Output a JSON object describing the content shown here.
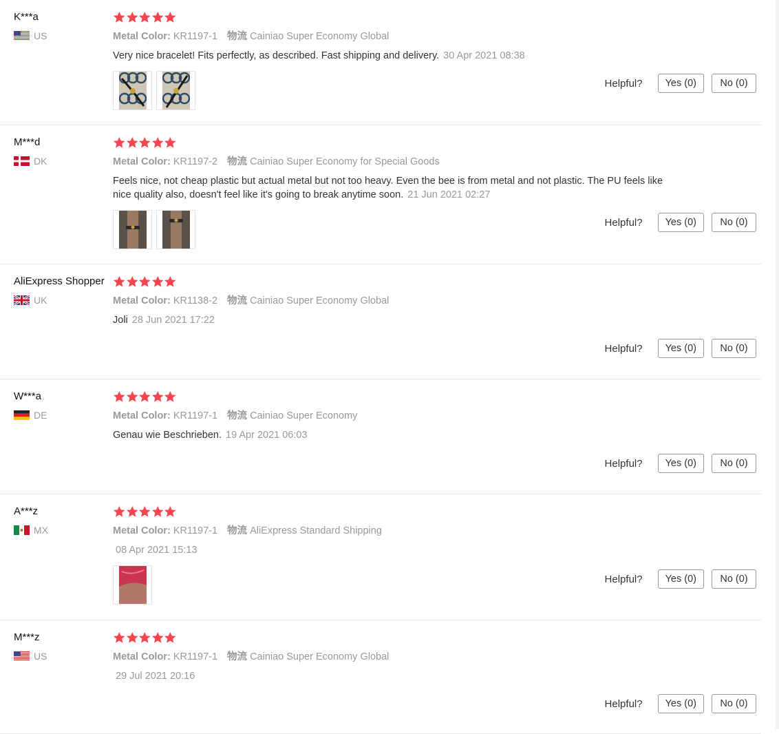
{
  "helpful_label": "Helpful?",
  "star_color": "#f7454f",
  "reviews": [
    {
      "user": "K***a",
      "country": "US",
      "flag": "us-flag-icon",
      "rating": 5,
      "attr_label": "Metal Color:",
      "attr_value": "KR1197-1",
      "ship_label": "物流",
      "ship_value": "Cainiao Super Economy Global",
      "text": "Very nice bracelet! Fits perfectly, as described. Fast shipping and delivery.",
      "date": "30 Apr 2021 08:38",
      "images": [
        "bracelet-photo-1",
        "bracelet-photo-2"
      ],
      "yes": "Yes (0)",
      "no": "No (0)"
    },
    {
      "user": "M***d",
      "country": "DK",
      "flag": "dk-flag-icon",
      "rating": 5,
      "attr_label": "Metal Color:",
      "attr_value": "KR1197-2",
      "ship_label": "物流",
      "ship_value": "Cainiao Super Economy for Special Goods",
      "text": "Feels nice, not cheap plastic but actual metal but not too heavy. Even the bee is from metal and not plastic. The PU feels like nice quality also, doesn't feel like it's going to break anytime soon.",
      "date": "21 Jun 2021 02:27",
      "images": [
        "wrist-photo-1",
        "wrist-photo-2"
      ],
      "yes": "Yes (0)",
      "no": "No (0)"
    },
    {
      "user": "AliExpress Shopper",
      "country": "UK",
      "flag": "uk-flag-icon",
      "rating": 5,
      "attr_label": "Metal Color:",
      "attr_value": "KR1138-2",
      "ship_label": "物流",
      "ship_value": "Cainiao Super Economy Global",
      "text": "Joli",
      "date": "28 Jun 2021 17:22",
      "images": [],
      "yes": "Yes (0)",
      "no": "No (0)"
    },
    {
      "user": "W***a",
      "country": "DE",
      "flag": "de-flag-icon",
      "rating": 5,
      "attr_label": "Metal Color:",
      "attr_value": "KR1197-1",
      "ship_label": "物流",
      "ship_value": "Cainiao Super Economy",
      "text": "Genau wie Beschrieben.",
      "date": "19 Apr 2021 06:03",
      "images": [],
      "yes": "Yes (0)",
      "no": "No (0)"
    },
    {
      "user": "A***z",
      "country": "MX",
      "flag": "mx-flag-icon",
      "rating": 5,
      "attr_label": "Metal Color:",
      "attr_value": "KR1197-1",
      "ship_label": "物流",
      "ship_value": "AliExpress Standard Shipping",
      "text": "",
      "date": "08 Apr 2021 15:13",
      "images": [
        "red-fabric-photo"
      ],
      "yes": "Yes (0)",
      "no": "No (0)"
    },
    {
      "user": "M***z",
      "country": "US",
      "flag": "us-flag-icon",
      "rating": 5,
      "attr_label": "Metal Color:",
      "attr_value": "KR1197-1",
      "ship_label": "物流",
      "ship_value": "Cainiao Super Economy Global",
      "text": "",
      "date": "29 Jul 2021 20:16",
      "images": [],
      "yes": "Yes (0)",
      "no": "No (0)"
    }
  ]
}
